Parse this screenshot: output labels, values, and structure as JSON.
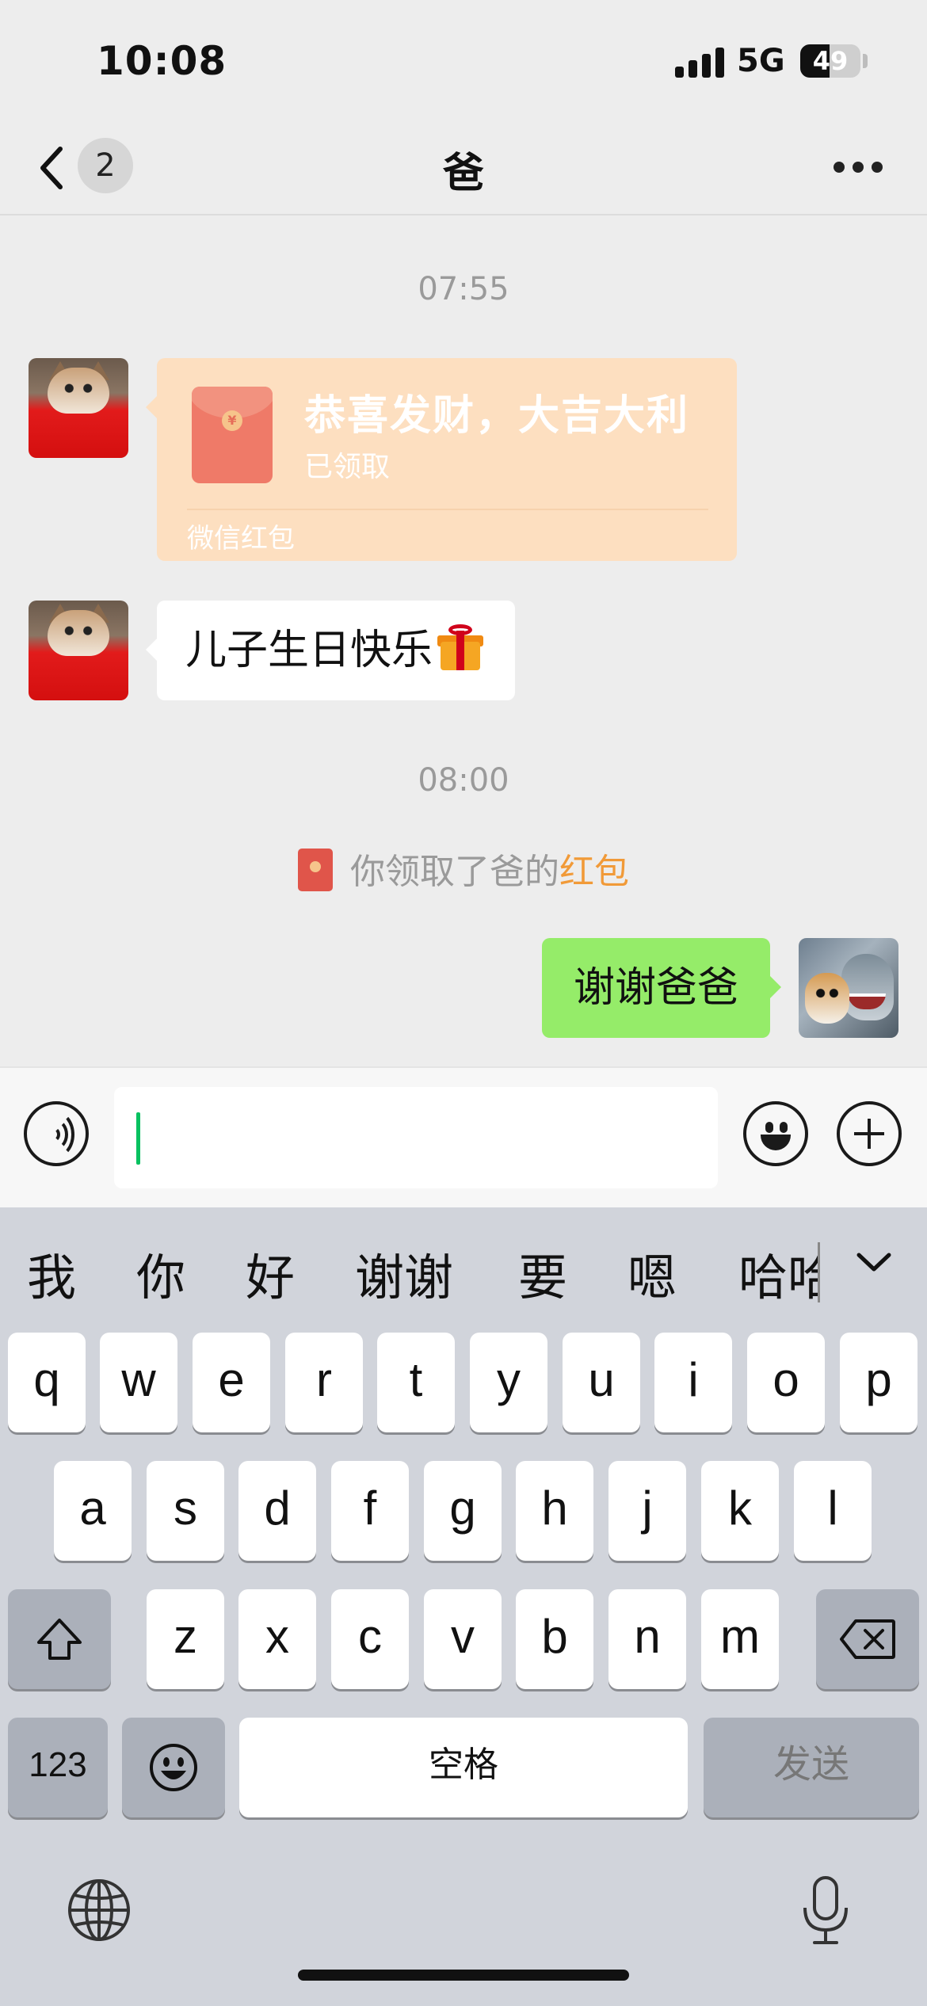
{
  "status_bar": {
    "time": "10:08",
    "network": "5G",
    "battery": "49",
    "battery_level": 0.49
  },
  "nav": {
    "back_unread_count": "2",
    "title": "爸"
  },
  "chat": {
    "timestamp_1": "07:55",
    "red_packet": {
      "title": "恭喜发财，大吉大利",
      "status": "已领取",
      "brand": "微信红包"
    },
    "message_1": "儿子生日快乐",
    "timestamp_2": "08:00",
    "system_notice": {
      "prefix": "你领取了爸的",
      "highlight": "红包"
    },
    "message_2": "谢谢爸爸"
  },
  "input": {
    "value": ""
  },
  "keyboard": {
    "candidates": [
      "我",
      "你",
      "好",
      "谢谢",
      "要",
      "嗯",
      "哈哈"
    ],
    "row1": [
      "q",
      "w",
      "e",
      "r",
      "t",
      "y",
      "u",
      "i",
      "o",
      "p"
    ],
    "row2": [
      "a",
      "s",
      "d",
      "f",
      "g",
      "h",
      "j",
      "k",
      "l"
    ],
    "row3": [
      "z",
      "x",
      "c",
      "v",
      "b",
      "n",
      "m"
    ],
    "numbers_key": "123",
    "space_key": "空格",
    "send_key": "发送"
  },
  "colors": {
    "accent_green": "#95ec69",
    "red_packet_bg": "#fddfc0",
    "notice_orange": "#f19a38",
    "caret": "#07c160"
  }
}
